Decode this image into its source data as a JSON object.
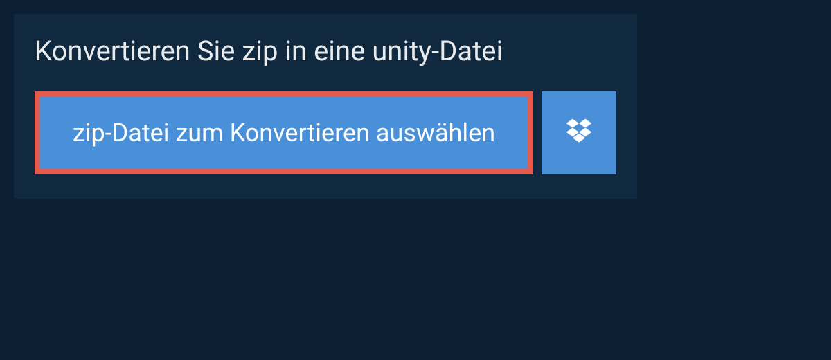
{
  "panel": {
    "heading": "Konvertieren Sie zip in eine unity-Datei",
    "select_file_label": "zip-Datei zum Konvertieren auswählen"
  },
  "colors": {
    "background": "#0b1f33",
    "panel": "#10293f",
    "button": "#4a90d9",
    "highlight_border": "#e35a4f",
    "text_light": "#e8ecef",
    "text_button": "#ffffff"
  }
}
